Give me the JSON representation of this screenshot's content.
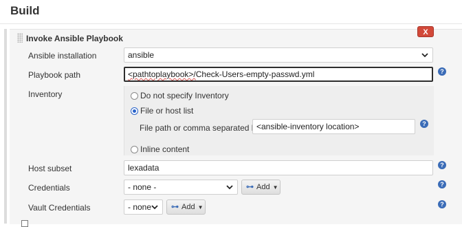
{
  "page": {
    "title": "Build"
  },
  "section": {
    "title": "Invoke Ansible Playbook",
    "delete_label": "X"
  },
  "fields": {
    "ansible_installation": {
      "label": "Ansible installation",
      "value": "ansible"
    },
    "playbook_path": {
      "label": "Playbook path",
      "value_prefix": "<pathtoplaybook>/",
      "value_main": "Check-Users-empty-passwd.yml"
    },
    "inventory": {
      "label": "Inventory",
      "options": [
        "Do not specify Inventory",
        "File or host list",
        "Inline content"
      ],
      "selected": "File or host list",
      "file_label": "File path or comma separated host list",
      "file_value": "<ansible-inventory location>"
    },
    "host_subset": {
      "label": "Host subset",
      "value": "lexadata"
    },
    "credentials": {
      "label": "Credentials",
      "value": "- none -",
      "add_label": "Add"
    },
    "vault_credentials": {
      "label": "Vault Credentials",
      "value": "- none -",
      "add_label": "Add"
    }
  },
  "icons": {
    "help": "?",
    "chevron": "❯",
    "key": "⊶",
    "caret": "▼"
  },
  "colors": {
    "delete": "#d24939",
    "help": "#3b6cb7",
    "radio_selected": "#2a63c9"
  }
}
